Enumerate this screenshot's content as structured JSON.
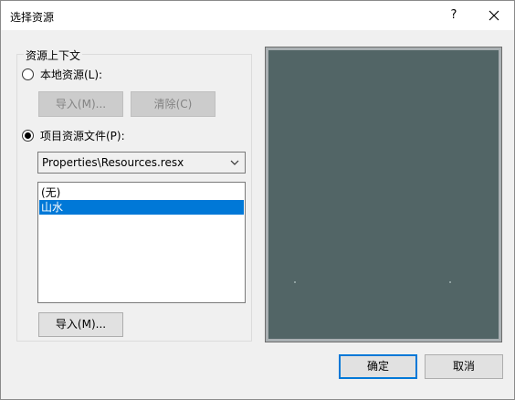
{
  "window": {
    "title": "选择资源",
    "help_label": "?"
  },
  "group": {
    "caption": "资源上下文",
    "local_radio_label": "本地资源(L):",
    "local_import_label": "导入(M)...",
    "local_clear_label": "清除(C)",
    "project_radio_label": "项目资源文件(P):",
    "project_file_selected": "Properties\\Resources.resx",
    "resource_list": [
      "(无)",
      "山水"
    ],
    "selected_index": 1,
    "project_import_label": "导入(M)..."
  },
  "footer": {
    "ok_label": "确定",
    "cancel_label": "取消"
  },
  "colors": {
    "selection": "#0078d7",
    "preview_fill": "#526566"
  }
}
